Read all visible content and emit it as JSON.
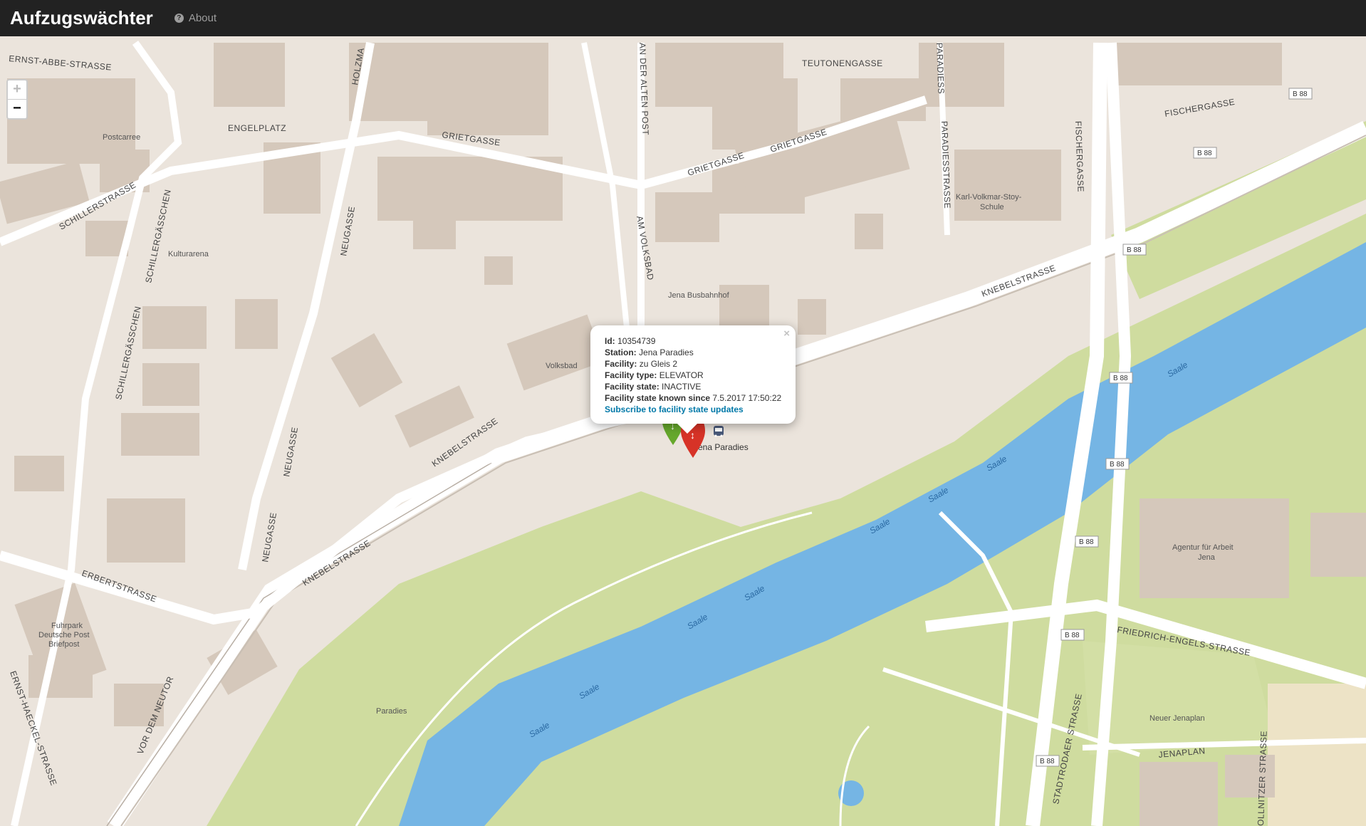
{
  "navbar": {
    "brand": "Aufzugswächter",
    "about_label": "About",
    "about_icon": "question-circle-icon"
  },
  "zoom": {
    "in_label": "+",
    "out_label": "−"
  },
  "popup": {
    "id_label": "Id:",
    "id_value": "10354739",
    "station_label": "Station:",
    "station_value": "Jena Paradies",
    "facility_label": "Facility:",
    "facility_value": "zu Gleis 2",
    "type_label": "Facility type:",
    "type_value": "ELEVATOR",
    "state_label": "Facility state:",
    "state_value": "INACTIVE",
    "known_label": "Facility state known since",
    "known_value": "7.5.2017 17:50:22",
    "subscribe_link": "Subscribe to facility state updates",
    "close_label": "×"
  },
  "map": {
    "colors": {
      "water": "#75b5e4",
      "park": "#cfdc9f",
      "building": "#d5c8bb",
      "land": "#ebe4dc",
      "road": "#ffffff",
      "marker_red": "#d73327",
      "marker_green": "#66a82c"
    },
    "station_label": "Jena Paradies",
    "streets": [
      "ERNST-ABBE-STRASSE",
      "TEUTONENGASSE",
      "FISCHERGASSE",
      "ENGELPLATZ",
      "GRIETGASSE",
      "GRIETGASSE",
      "GRIETGASSE",
      "SCHILLERSTRASSE",
      "SCHILLERGÄSSCHEN",
      "SCHILLERGÄSSCHEN",
      "NEUGASSE",
      "NEUGASSE",
      "NEUGASSE",
      "KNEBELSTRASSE",
      "KNEBELSTRASSE",
      "KNEBELSTRASSE",
      "AM VOLKSBAD",
      "PARADIESSTRASSE",
      "FISCHERGASSE",
      "ERBERTSTRASSE",
      "VOR DEM NEUTOR",
      "ERNST-HAECKEL-STRASSE",
      "FRIEDRICH-ENGELS-STRASSE",
      "STADTRODAER STRASSE",
      "JENAPLAN",
      "OLLNITZER STRASSE",
      "HOLZMA",
      "AN DER ALTEN POST",
      "PARADIESS"
    ],
    "places": [
      "Postcarree",
      "Kulturarena",
      "Jena Busbahnhof",
      "Volksbad",
      "Karl-Volkmar-Stoy-Schule",
      "Agentur für Arbeit Jena",
      "Fuhrpark Deutsche Post Briefpost",
      "Paradies",
      "Neuer Jenaplan"
    ],
    "river": "Saale",
    "route": "B 88"
  }
}
